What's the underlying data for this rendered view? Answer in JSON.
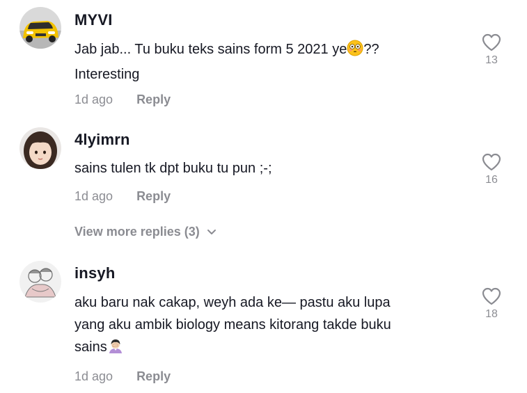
{
  "comments": [
    {
      "username": "MYVI",
      "text_before_emoji": "Jab jab... Tu buku teks sains form 5 2021 ye",
      "emoji": "flushed-face-emoji",
      "text_after_emoji": "??",
      "text_line2": "Interesting",
      "time": "1d ago",
      "reply_label": "Reply",
      "likes": "13"
    },
    {
      "username": "4lyimrn",
      "text": "sains tulen tk dpt buku tu pun ;-;",
      "time": "1d ago",
      "reply_label": "Reply",
      "likes": "16"
    },
    {
      "username": "insyh",
      "text_line1": "aku baru nak cakap, weyh ada ke— pastu aku lupa",
      "text_line2": "yang aku ambik biology means kitorang takde buku",
      "text_line3": "sains",
      "emoji": "person-facepalming-emoji",
      "time": "1d ago",
      "reply_label": "Reply",
      "likes": "18"
    }
  ],
  "view_more_replies": "View more replies (3)",
  "colors": {
    "text_primary": "#161823",
    "text_secondary": "rgba(22,24,35,0.5)",
    "car_yellow": "#f2c200"
  }
}
